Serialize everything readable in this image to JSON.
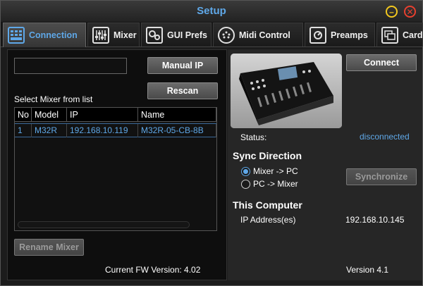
{
  "window": {
    "title": "Setup",
    "minimize_glyph": "–",
    "close_glyph": "✕"
  },
  "tabs": [
    {
      "label": "Connection",
      "icon": "grid-icon",
      "active": true
    },
    {
      "label": "Mixer",
      "icon": "faders-icon"
    },
    {
      "label": "GUI Prefs",
      "icon": "gears-icon"
    },
    {
      "label": "Midi Control",
      "icon": "midi-port-icon"
    },
    {
      "label": "Preamps",
      "icon": "knob-icon"
    },
    {
      "label": "Card",
      "icon": "card-icon"
    }
  ],
  "connection": {
    "ip_input_value": "",
    "manual_ip_label": "Manual IP",
    "rescan_label": "Rescan",
    "select_mixer_label": "Select Mixer from list",
    "table": {
      "columns": [
        "No",
        "Model",
        "IP",
        "Name"
      ],
      "rows": [
        {
          "no": "1",
          "model": "M32R",
          "ip": "192.168.10.119",
          "name": "M32R-05-CB-8B"
        }
      ]
    },
    "rename_mixer_label": "Rename Mixer",
    "fw_version": "Current FW Version: 4.02"
  },
  "right": {
    "connect_label": "Connect",
    "status_label": "Status:",
    "status_value": "disconnected",
    "sync_direction_title": "Sync Direction",
    "sync_options": [
      "Mixer -> PC",
      "PC -> Mixer"
    ],
    "sync_selected": "Mixer -> PC",
    "synchronize_label": "Synchronize",
    "this_computer_title": "This Computer",
    "ip_addresses_label": "IP Address(es)",
    "ip_address_value": "192.168.10.145",
    "version": "Version 4.1"
  },
  "colors": {
    "accent": "#5fa8e8",
    "minimize": "#f2c81e",
    "close": "#e8402f"
  }
}
